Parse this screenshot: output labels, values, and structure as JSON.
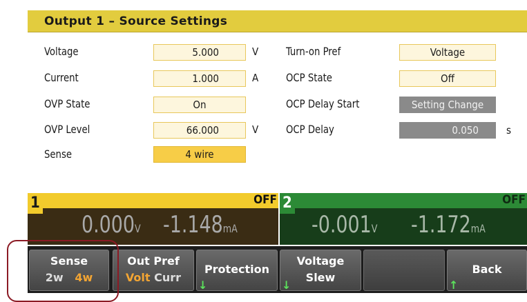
{
  "header": {
    "title": "Output 1 – Source Settings"
  },
  "settings": {
    "voltage": {
      "label": "Voltage",
      "value": "5.000",
      "unit": "V"
    },
    "current": {
      "label": "Current",
      "value": "1.000",
      "unit": "A"
    },
    "ovp_state": {
      "label": "OVP State",
      "value": "On"
    },
    "ovp_level": {
      "label": "OVP Level",
      "value": "66.000",
      "unit": "V"
    },
    "sense": {
      "label": "Sense",
      "value": "4 wire"
    },
    "turn_on_pref": {
      "label": "Turn-on Pref",
      "value": "Voltage"
    },
    "ocp_state": {
      "label": "OCP State",
      "value": "Off"
    },
    "ocp_delay_start": {
      "label": "OCP Delay Start",
      "value": "Setting Change"
    },
    "ocp_delay": {
      "label": "OCP Delay",
      "value": "0.050",
      "unit": "s"
    }
  },
  "channels": [
    {
      "number": "1",
      "status": "OFF",
      "voltage": "0.000",
      "voltage_unit": "V",
      "current": "-1.148",
      "current_unit": "mA",
      "color": "#f2cb2c"
    },
    {
      "number": "2",
      "status": "OFF",
      "voltage": "-0.001",
      "voltage_unit": "V",
      "current": "-1.172",
      "current_unit": "mA",
      "color": "#2c8a36"
    }
  ],
  "softkeys": {
    "sense": {
      "label": "Sense",
      "opt_a": "2w",
      "opt_b": "4w",
      "selected": "4w"
    },
    "out_pref": {
      "label": "Out Pref",
      "opt_a": "Volt",
      "opt_b": "Curr",
      "selected": "Volt"
    },
    "protection": {
      "label": "Protection"
    },
    "voltage_slew": {
      "label_1": "Voltage",
      "label_2": "Slew"
    },
    "back": {
      "label": "Back"
    }
  },
  "icons": {
    "submenu_arrow": "arrow-down-icon",
    "back_arrow": "arrow-up-icon"
  },
  "colors": {
    "title_bar": "#e2cc3e",
    "field_active": "#f7cd47",
    "selected_option": "#f3a533",
    "arrow": "#5ce25c",
    "callout": "#8b1a24"
  }
}
